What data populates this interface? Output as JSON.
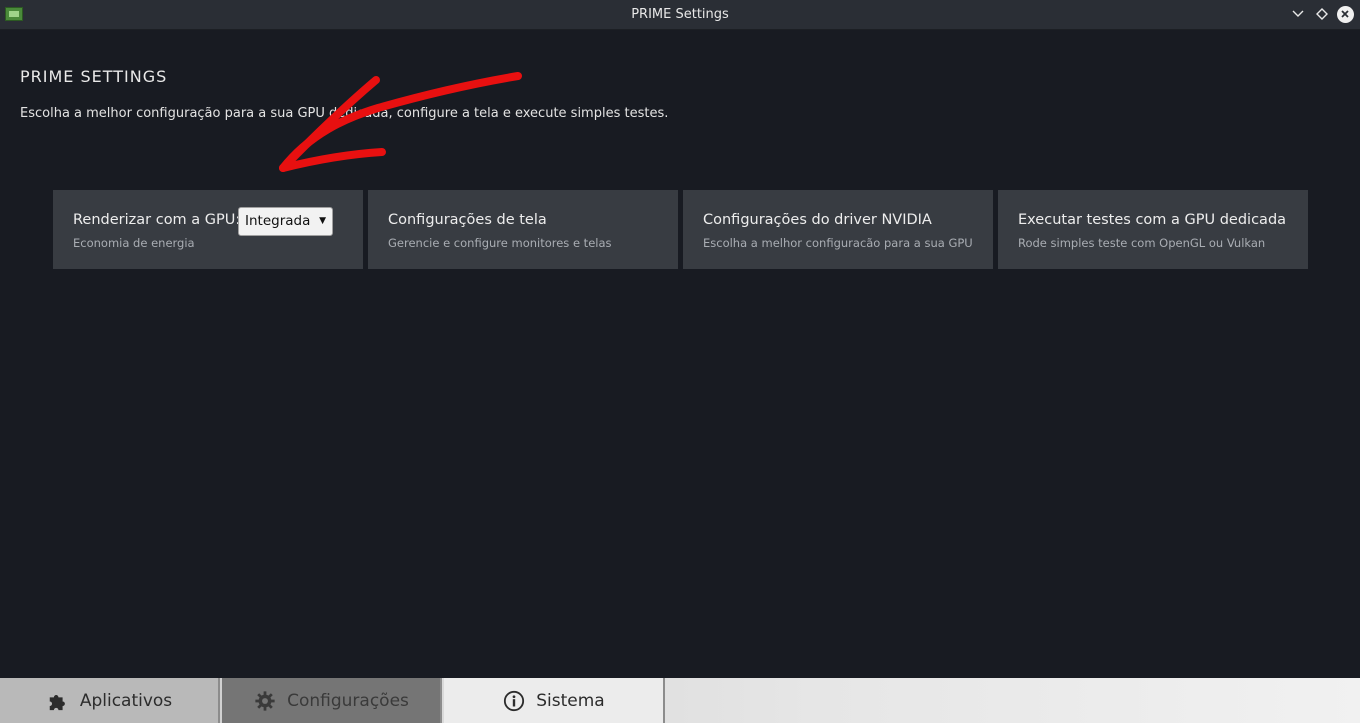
{
  "window": {
    "title": "PRIME Settings",
    "app_icon": "gpu-card-icon",
    "controls": [
      "minimize-icon",
      "maximize-icon",
      "close-icon"
    ]
  },
  "header": {
    "title": "PRIME SETTINGS",
    "description": "Escolha a melhor configuração para a sua GPU dedicada, configure a tela e execute simples testes."
  },
  "cards": [
    {
      "title": "Renderizar com a GPU:",
      "subtitle": "Economia de energia",
      "select": {
        "value": "Integrada"
      }
    },
    {
      "title": "Configurações de tela",
      "subtitle": "Gerencie e configure monitores e telas"
    },
    {
      "title": "Configurações do driver NVIDIA",
      "subtitle": "Escolha a melhor configuracão para a sua GPU"
    },
    {
      "title": "Executar testes com a GPU dedicada",
      "subtitle": "Rode simples teste com OpenGL ou Vulkan"
    }
  ],
  "tabs": [
    {
      "label": "Aplicativos",
      "icon": "puzzle-icon",
      "active": false
    },
    {
      "label": "Configurações",
      "icon": "gear-icon",
      "active": true
    },
    {
      "label": "Sistema",
      "icon": "info-icon",
      "active": false
    }
  ],
  "colors": {
    "background": "#181b22",
    "card": "#383c42",
    "annotation": "#e81010"
  }
}
